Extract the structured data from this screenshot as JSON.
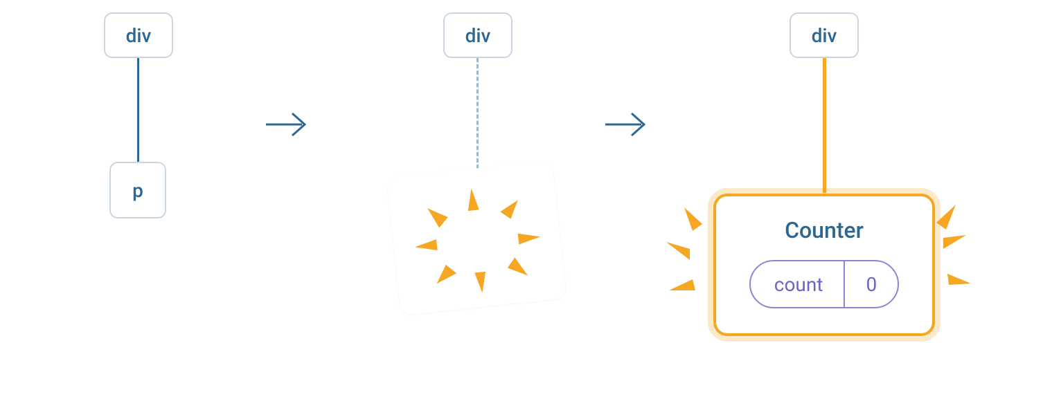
{
  "stages": {
    "s1": {
      "parent": "div",
      "child": "p"
    },
    "s2": {
      "parent": "div"
    },
    "s3": {
      "parent": "div",
      "counter_title": "Counter",
      "state_label": "count",
      "state_value": "0"
    }
  },
  "colors": {
    "node_text": "#2b6793",
    "highlight": "#f5a623",
    "state_border": "#8a86d5"
  }
}
